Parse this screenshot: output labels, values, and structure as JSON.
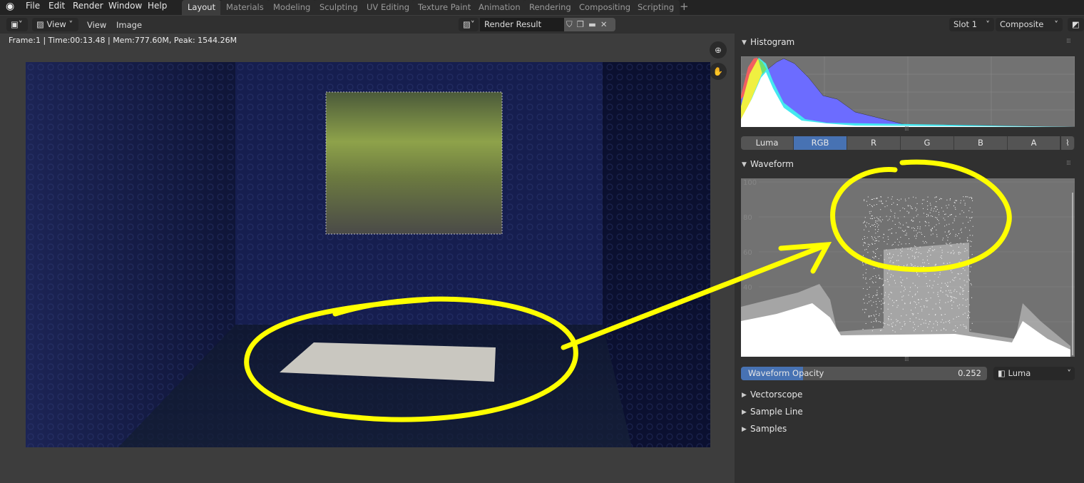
{
  "menu": [
    "File",
    "Edit",
    "Render",
    "Window",
    "Help"
  ],
  "workspaces": [
    "Layout",
    "Materials",
    "Modeling",
    "Sculpting",
    "UV Editing",
    "Texture Paint",
    "Animation",
    "Rendering",
    "Compositing",
    "Scripting"
  ],
  "active_workspace": "Layout",
  "header": {
    "view_dropdown": "View",
    "view_menu": "View",
    "image_menu": "Image",
    "image_name": "Render Result",
    "slot": "Slot 1",
    "layer": "Composite"
  },
  "status": "Frame:1 | Time:00:13.48 | Mem:777.60M, Peak: 1544.26M",
  "histogram": {
    "title": "Histogram",
    "modes": [
      "Luma",
      "RGB",
      "R",
      "G",
      "B",
      "A"
    ],
    "selected_mode": "RGB"
  },
  "waveform": {
    "title": "Waveform",
    "scale_labels": [
      "100",
      "80",
      "60",
      "40",
      "20"
    ],
    "opacity_label": "Waveform Opacity",
    "opacity_value": "0.252",
    "opacity_fraction": 0.252,
    "mode": "Luma"
  },
  "collapsed_panels": [
    "Vectorscope",
    "Sample Line",
    "Samples"
  ],
  "colors": {
    "accent": "#4772b3",
    "annotation": "#ffff00"
  }
}
